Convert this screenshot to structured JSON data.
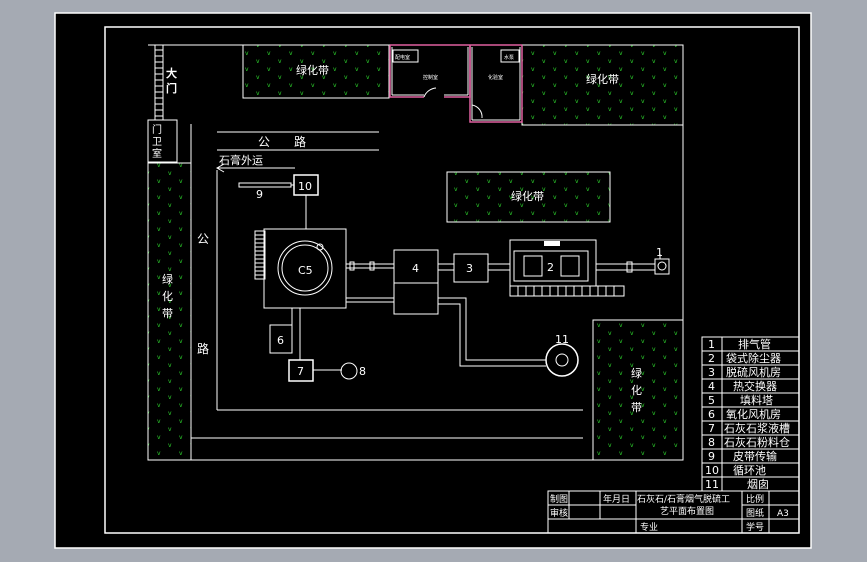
{
  "labels": {
    "gate": "大门",
    "guard_room": "门卫室",
    "green_top_left": "绿化带",
    "green_top_right": "绿化带",
    "green_middle": "绿化带",
    "green_left": "绿化带",
    "green_right_bottom": "绿化带",
    "road_top": "公　　路",
    "road_left_1": "公",
    "road_left_2": "路",
    "gypsum_out": "石膏外运",
    "bldg_small_1": "配电室",
    "bldg_small_2": "水泵",
    "bldg_room_1": "控制室",
    "bldg_room_2": "化验室"
  },
  "equipment": [
    {
      "num": "1",
      "name": "排气管"
    },
    {
      "num": "2",
      "name": "袋式除尘器"
    },
    {
      "num": "3",
      "name": "脱硫风机房"
    },
    {
      "num": "4",
      "name": "热交换器"
    },
    {
      "num": "5",
      "name": "填料塔"
    },
    {
      "num": "6",
      "name": "氧化风机房"
    },
    {
      "num": "7",
      "name": "石灰石浆液槽"
    },
    {
      "num": "8",
      "name": "石灰石粉料仓"
    },
    {
      "num": "9",
      "name": "皮带传输"
    },
    {
      "num": "10",
      "name": "循环池"
    },
    {
      "num": "11",
      "name": "烟囱"
    }
  ],
  "title_block": {
    "drawn": "制图",
    "checked": "审核",
    "date": "年月日",
    "title_1": "石灰石/石膏烟气脱硫工",
    "title_2": "艺平面布置图",
    "scale": "比例",
    "sheet": "图纸",
    "sheet_size": "A3",
    "major": "专业",
    "no": "学号"
  },
  "colors": {
    "background": "#000000",
    "frame": "#ffffff",
    "green_dot": "#2cd62c",
    "building": "#e060a0",
    "outer": "#a5aab3"
  }
}
